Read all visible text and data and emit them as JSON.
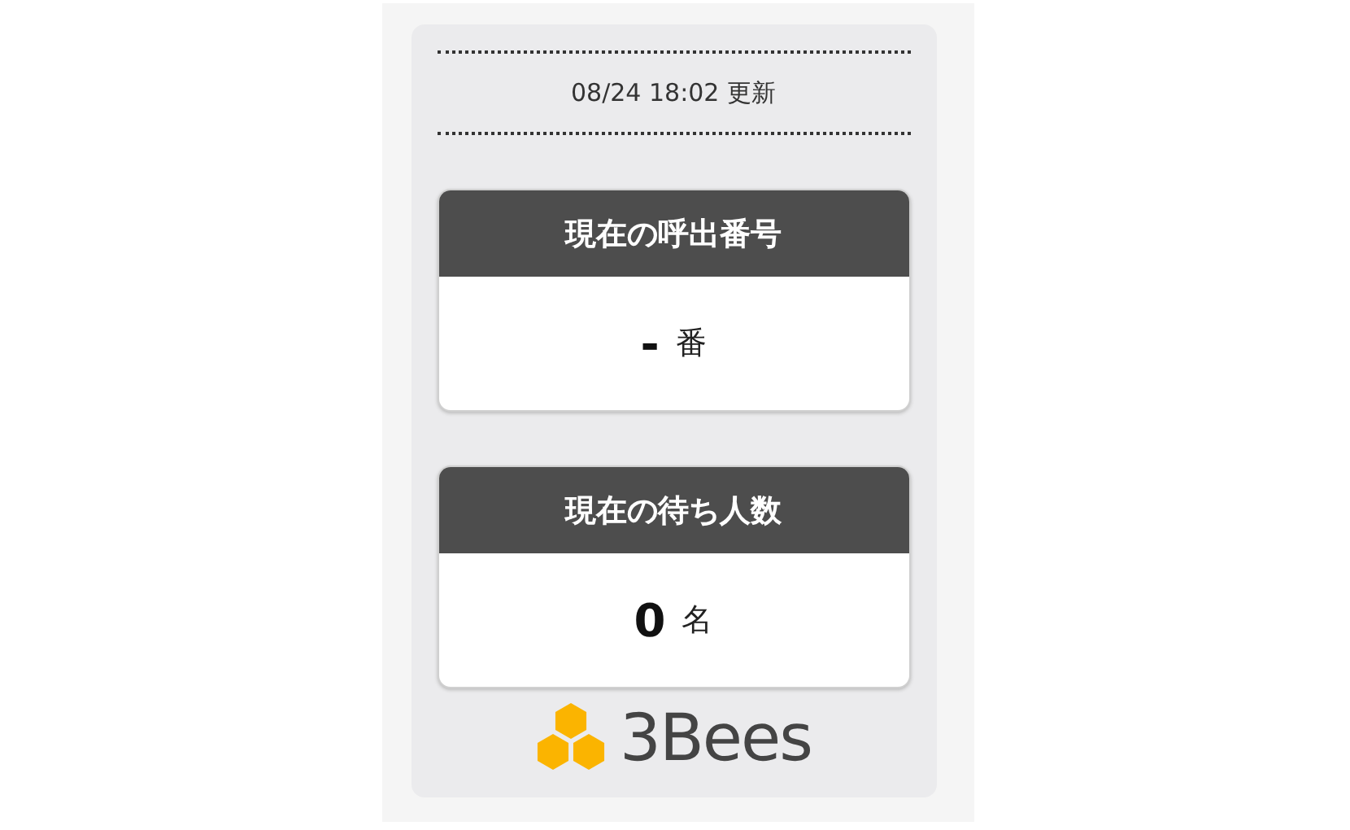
{
  "updated": "08/24 18:02 更新",
  "cards": [
    {
      "title": "現在の呼出番号",
      "value": "-",
      "unit": "番"
    },
    {
      "title": "現在の待ち人数",
      "value": "0",
      "unit": "名"
    }
  ],
  "logo": {
    "text": "3Bees"
  }
}
